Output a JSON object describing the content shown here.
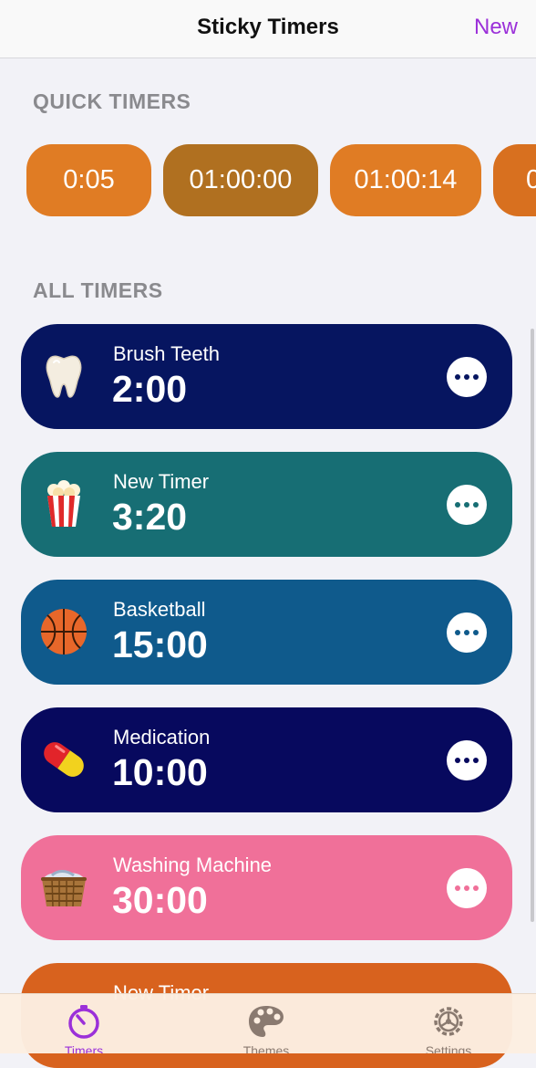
{
  "navbar": {
    "title": "Sticky Timers",
    "new_label": "New"
  },
  "sections": {
    "quick": "QUICK TIMERS",
    "all": "ALL TIMERS"
  },
  "quick_timers": [
    {
      "label": "0:05",
      "color": "#e07c24"
    },
    {
      "label": "01:00:00",
      "color": "#b07020"
    },
    {
      "label": "01:00:14",
      "color": "#e07c24"
    },
    {
      "label": "0",
      "color": "#d8701f"
    }
  ],
  "timers": [
    {
      "name": "Brush Teeth",
      "time": "2:00",
      "color": "#061560",
      "icon": "tooth-icon"
    },
    {
      "name": "New Timer",
      "time": "3:20",
      "color": "#176e74",
      "icon": "popcorn-icon"
    },
    {
      "name": "Basketball",
      "time": "15:00",
      "color": "#0f5a8c",
      "icon": "basketball-icon"
    },
    {
      "name": "Medication",
      "time": "10:00",
      "color": "#07095e",
      "icon": "pill-icon"
    },
    {
      "name": "Washing Machine",
      "time": "30:00",
      "color": "#f07099",
      "icon": "laundry-basket-icon"
    },
    {
      "name": "New Timer",
      "time": "",
      "color": "#d8621e",
      "icon": ""
    }
  ],
  "tabs": [
    {
      "label": "Timers",
      "icon": "stopwatch-icon",
      "active": true,
      "color": "#9b30d9"
    },
    {
      "label": "Themes",
      "icon": "palette-icon",
      "active": false,
      "color": "#8a7a70"
    },
    {
      "label": "Settings",
      "icon": "gear-icon",
      "active": false,
      "color": "#8a7a70"
    }
  ]
}
